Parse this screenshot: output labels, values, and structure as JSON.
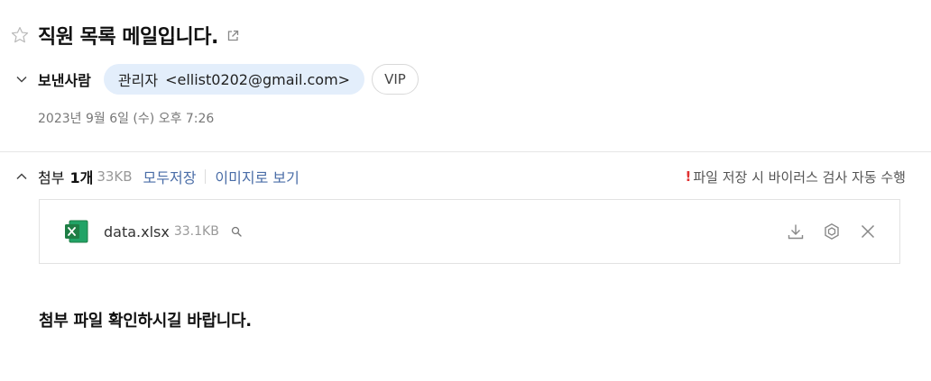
{
  "mail": {
    "subject": "직원 목록 메일입니다.",
    "sender_label": "보낸사람",
    "sender_name": "관리자",
    "sender_email": "<ellist0202@gmail.com>",
    "vip_label": "VIP",
    "date": "2023년 9월 6일 (수) 오후 7:26",
    "body": "첨부 파일 확인하시길 바랍니다."
  },
  "attachments": {
    "label": "첨부",
    "count": "1개",
    "total_size": "33KB",
    "save_all_label": "모두저장",
    "view_image_label": "이미지로 보기",
    "scan_mark": "!",
    "scan_note": "파일 저장 시 바이러스 검사 자동 수행",
    "files": [
      {
        "name": "data.xlsx",
        "size": "33.1KB",
        "icon": "excel-file-icon"
      }
    ]
  },
  "icons": {
    "star": "star-outline-icon",
    "external": "external-link-icon",
    "collapse": "chevron-down-icon",
    "expand": "chevron-up-icon",
    "preview": "search-icon",
    "download": "download-icon",
    "scan": "hexagon-scan-icon",
    "delete": "close-icon"
  },
  "colors": {
    "chip_bg": "#e3eefb",
    "link": "#4a6da7",
    "excel_green": "#1e7e45",
    "warning": "#e03131"
  }
}
